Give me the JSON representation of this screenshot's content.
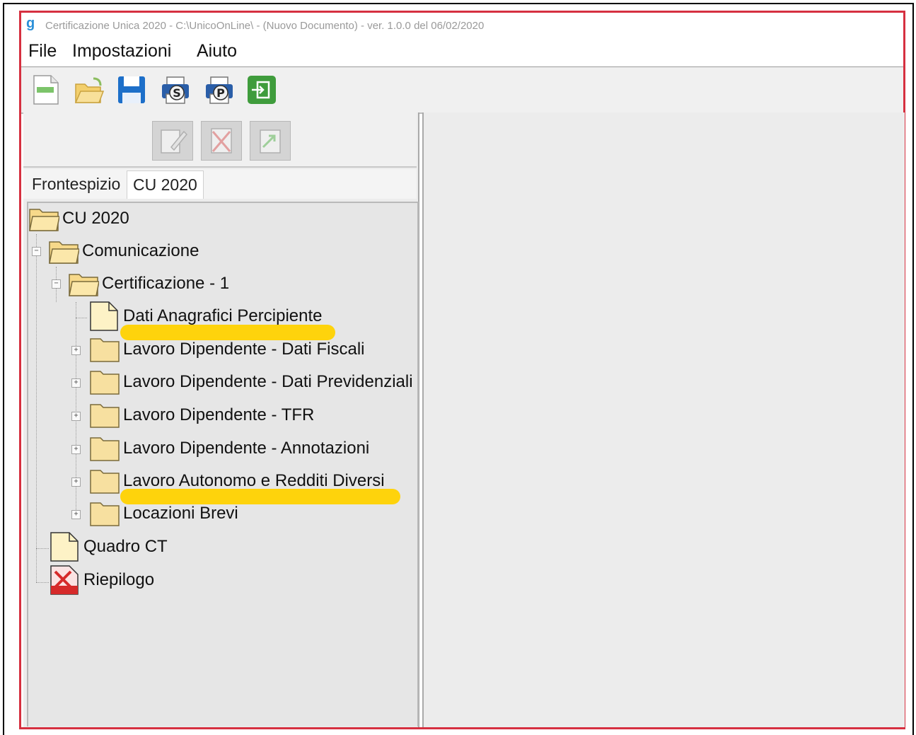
{
  "window": {
    "title": "Certificazione Unica 2020 - C:\\UnicoOnLine\\ - (Nuovo Documento)  -  ver. 1.0.0 del 06/02/2020"
  },
  "menu": {
    "file": "File",
    "impostazioni": "Impostazioni",
    "aiuto": "Aiuto"
  },
  "toolbar": {
    "icons": [
      "new-document-icon",
      "open-folder-icon",
      "save-icon",
      "print-s-icon",
      "print-p-icon",
      "exit-icon"
    ]
  },
  "sub_toolbar": {
    "icons": [
      "edit-icon",
      "delete-icon",
      "export-icon"
    ]
  },
  "tabs": {
    "frontespizio": "Frontespizio",
    "cu2020": "CU 2020"
  },
  "tree": {
    "root": "CU 2020",
    "comunicazione": "Comunicazione",
    "certificazione": "Certificazione - 1",
    "items": [
      "Dati Anagrafici Percipiente",
      "Lavoro Dipendente - Dati Fiscali",
      "Lavoro Dipendente - Dati Previdenziali",
      "Lavoro Dipendente - TFR",
      "Lavoro Dipendente - Annotazioni",
      "Lavoro Autonomo e Redditi Diversi",
      "Locazioni Brevi"
    ],
    "quadro_ct": "Quadro CT",
    "riepilogo": "Riepilogo"
  },
  "colors": {
    "window_border": "#d63040",
    "highlight": "#ffd200",
    "folder": "#f7d98a"
  }
}
